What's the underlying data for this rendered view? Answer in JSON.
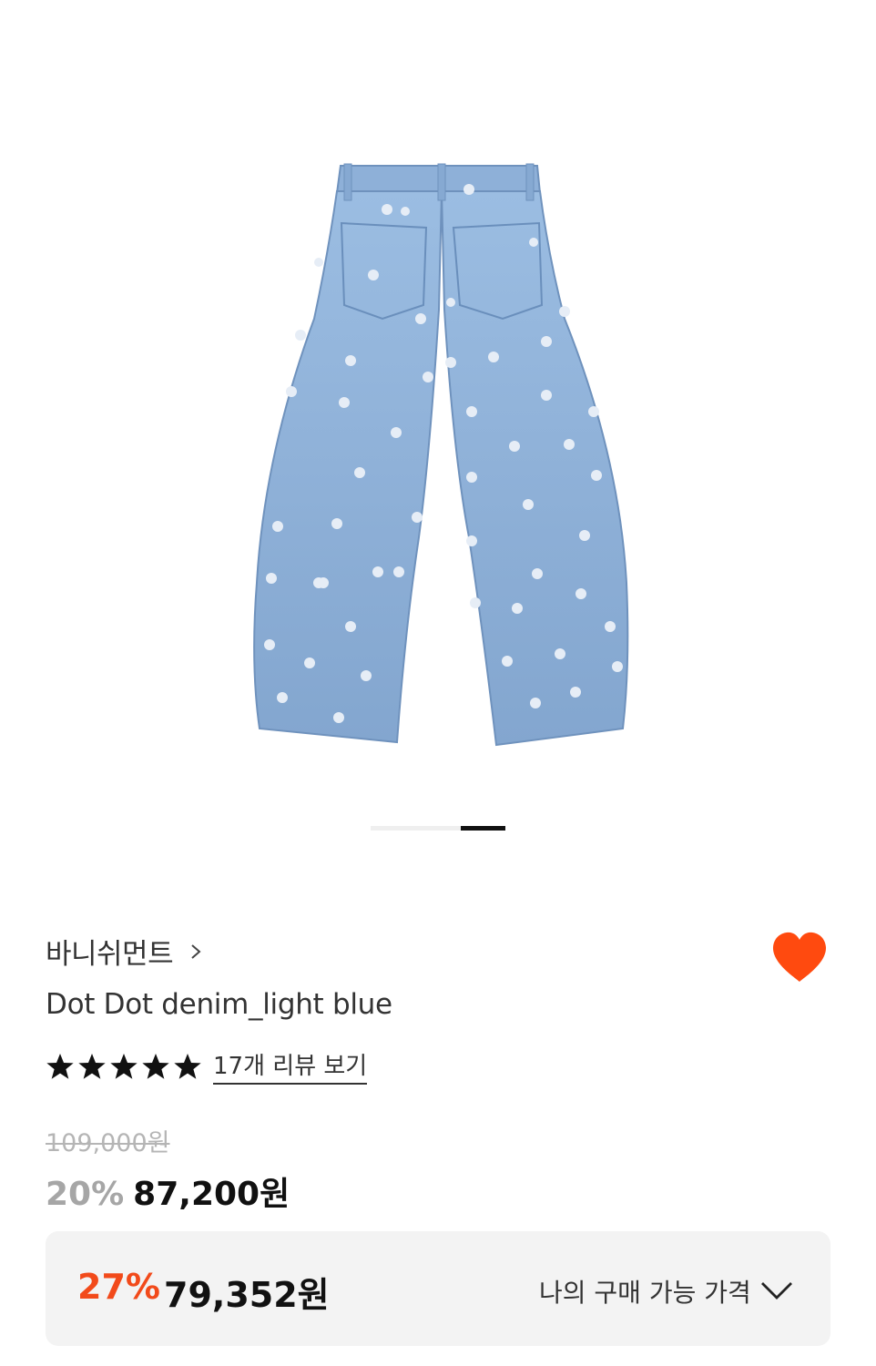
{
  "product": {
    "brand": "바니쉬먼트",
    "name": "Dot Dot denim_light blue",
    "review_link": "17개 리뷰 보기",
    "rating_stars": 5,
    "original_price": "109,000원",
    "discount_rate": "20%",
    "sale_price": "87,200원"
  },
  "gallery": {
    "image_count": 2,
    "active_index": 1
  },
  "my_price": {
    "discount_rate": "27%",
    "price": "79,352원",
    "label": "나의 구매 가능 가격"
  },
  "colors": {
    "accent": "#f24a1a",
    "heart": "#ff4a0f",
    "denim": "#8fb1d8",
    "denim_dark": "#7a9cc6",
    "dot": "#e8eef5"
  },
  "icons": {
    "brand_chevron": "chevron-right-icon",
    "wishlist": "heart-icon",
    "star": "star-icon",
    "expand": "chevron-down-icon"
  },
  "wishlist_active": true
}
